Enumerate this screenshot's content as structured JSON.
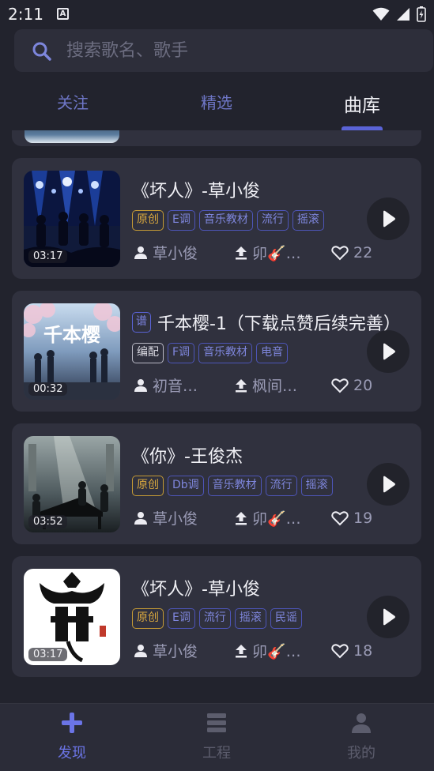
{
  "status_bar": {
    "time": "2:11",
    "notification_glyph": "A"
  },
  "search": {
    "placeholder": "搜索歌名、歌手"
  },
  "tabs": [
    {
      "label": "关注",
      "active": false
    },
    {
      "label": "精选",
      "active": false
    },
    {
      "label": "曲库",
      "active": true
    }
  ],
  "songs": [
    {
      "title": "《坏人》-草小俊",
      "score_badge": "",
      "duration": "03:17",
      "tags": [
        {
          "label": "原创",
          "kind": "orig"
        },
        {
          "label": "E调",
          "kind": "normal"
        },
        {
          "label": "音乐教材",
          "kind": "normal"
        },
        {
          "label": "流行",
          "kind": "normal"
        },
        {
          "label": "摇滚",
          "kind": "normal"
        }
      ],
      "author": "草小俊",
      "uploader": "卯🎸…",
      "likes": "22"
    },
    {
      "title": "千本樱-1（下载点赞后续完善）",
      "score_badge": "谱",
      "duration": "00:32",
      "tags": [
        {
          "label": "编配",
          "kind": "arr"
        },
        {
          "label": "F调",
          "kind": "normal"
        },
        {
          "label": "音乐教材",
          "kind": "normal"
        },
        {
          "label": "电音",
          "kind": "normal"
        }
      ],
      "author": "初音…",
      "uploader": "枫间…",
      "likes": "20"
    },
    {
      "title": "《你》-王俊杰",
      "score_badge": "",
      "duration": "03:52",
      "tags": [
        {
          "label": "原创",
          "kind": "orig"
        },
        {
          "label": "Db调",
          "kind": "normal"
        },
        {
          "label": "音乐教材",
          "kind": "normal"
        },
        {
          "label": "流行",
          "kind": "normal"
        },
        {
          "label": "摇滚",
          "kind": "normal"
        }
      ],
      "author": "草小俊",
      "uploader": "卯🎸…",
      "likes": "19"
    },
    {
      "title": "《坏人》-草小俊",
      "score_badge": "",
      "duration": "03:17",
      "tags": [
        {
          "label": "原创",
          "kind": "orig"
        },
        {
          "label": "E调",
          "kind": "normal"
        },
        {
          "label": "流行",
          "kind": "normal"
        },
        {
          "label": "摇滚",
          "kind": "normal"
        },
        {
          "label": "民谣",
          "kind": "normal"
        }
      ],
      "author": "草小俊",
      "uploader": "卯🎸…",
      "likes": "18"
    }
  ],
  "thumb2_text": "千本樱",
  "bottom_nav": [
    {
      "label": "发现",
      "icon": "plus-icon",
      "active": true
    },
    {
      "label": "工程",
      "icon": "stack-icon",
      "active": false
    },
    {
      "label": "我的",
      "icon": "person-icon",
      "active": false
    }
  ],
  "colors": {
    "accent": "#5a63d6",
    "background": "#22232d",
    "card": "#30313e",
    "original_tag": "#d9a83e"
  }
}
